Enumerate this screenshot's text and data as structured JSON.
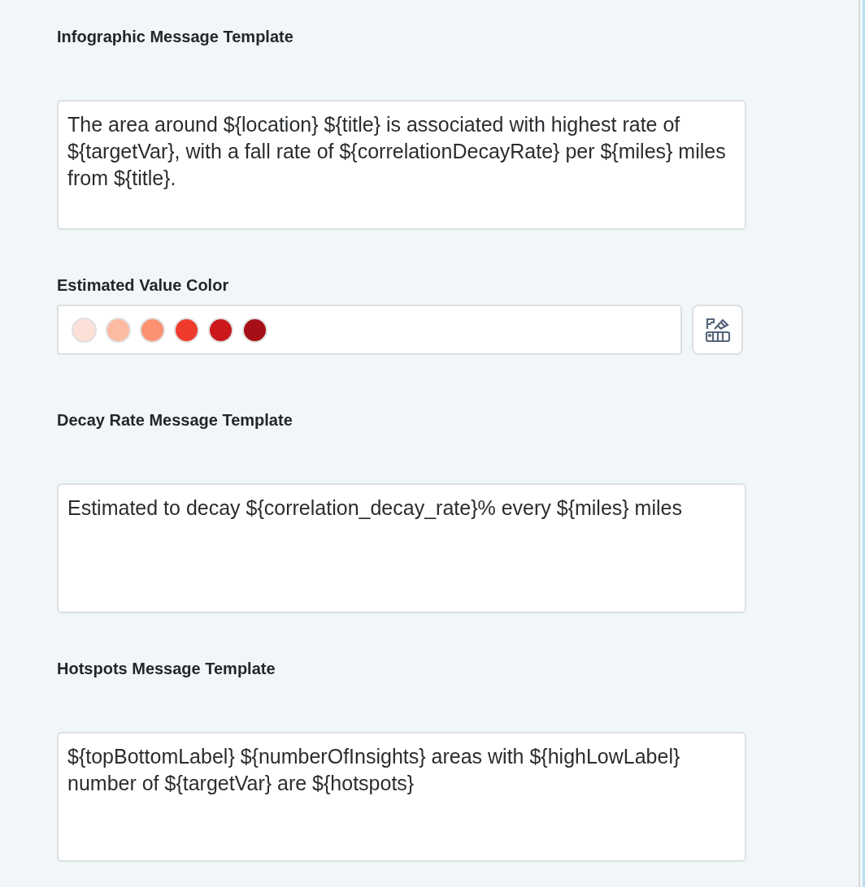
{
  "fields": [
    {
      "kind": "template",
      "label": "Infographic Message Template",
      "value": "The area around ${location} ${title} is associated with highest rate of ${targetVar}, with a fall rate of ${correlationDecayRate} per ${miles} miles from ${title}."
    },
    {
      "kind": "color",
      "label": "Estimated Value Color",
      "swatches": [
        {
          "color": "#fde0d8"
        },
        {
          "color": "#fcbba1"
        },
        {
          "color": "#fc9272"
        },
        {
          "color": "#ef3b2c"
        },
        {
          "color": "#cb181d"
        },
        {
          "color": "#a50f15"
        }
      ]
    },
    {
      "kind": "template",
      "label": "Decay Rate Message Template",
      "value": "Estimated to decay ${correlation_decay_rate}% every ${miles} miles"
    },
    {
      "kind": "template",
      "label": "Hotspots Message Template",
      "value": "${topBottomLabel} ${numberOfInsights} areas with ${highLowLabel} number of ${targetVar} are ${hotspots}"
    }
  ]
}
